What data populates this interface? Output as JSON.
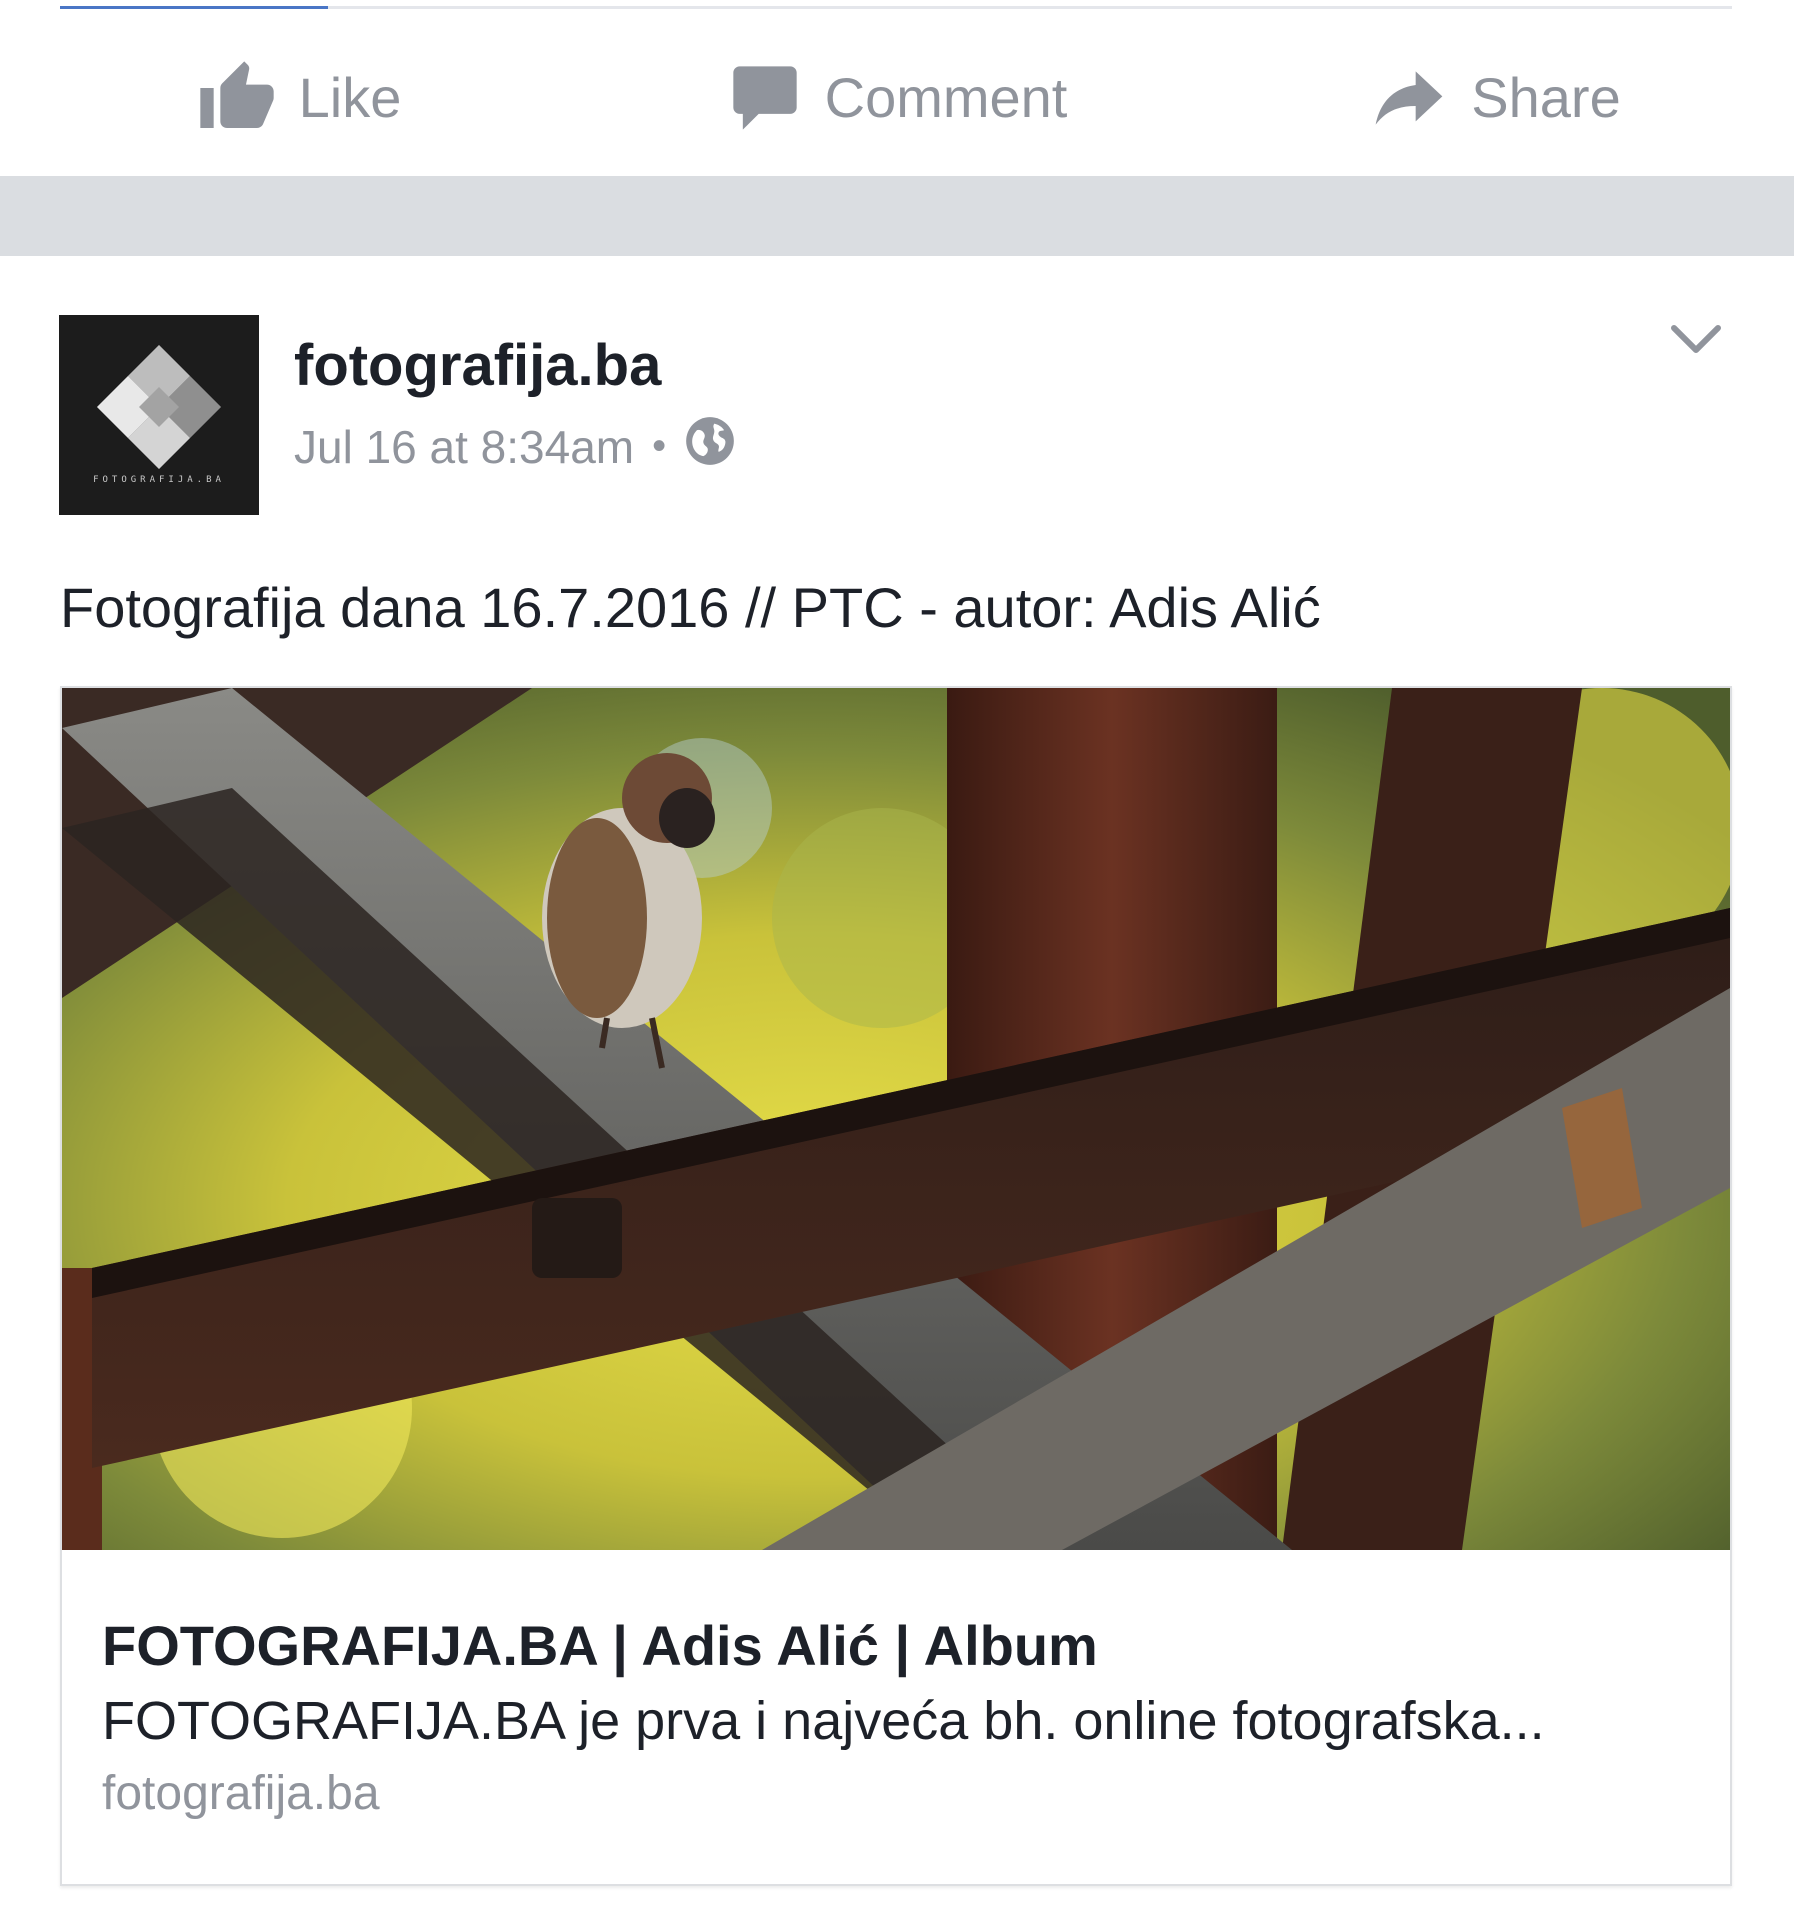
{
  "actions": {
    "like_label": "Like",
    "comment_label": "Comment",
    "share_label": "Share",
    "icon_color": "#90949c"
  },
  "post": {
    "page_name": "fotografija.ba",
    "timestamp": "Jul 16 at 8:34am",
    "separator": "•",
    "privacy_icon": "globe-icon",
    "avatar_logo_text": "FOTOGRAFIJA.BA",
    "text": "Fotografija dana 16.7.2016 // PTC - autor: Adis Alić"
  },
  "link_card": {
    "image": "photo-of-sparrow-on-metal-beams",
    "title": "FOTOGRAFIJA.BA | Adis Alić | Album",
    "description": "FOTOGRAFIJA.BA je prva i najveća bh. online fotografska...",
    "domain": "fotografija.ba"
  },
  "colors": {
    "text_primary": "#1d2129",
    "text_secondary": "#90949c",
    "feed_separator": "#dadde1",
    "progress": "#4a76c6"
  }
}
